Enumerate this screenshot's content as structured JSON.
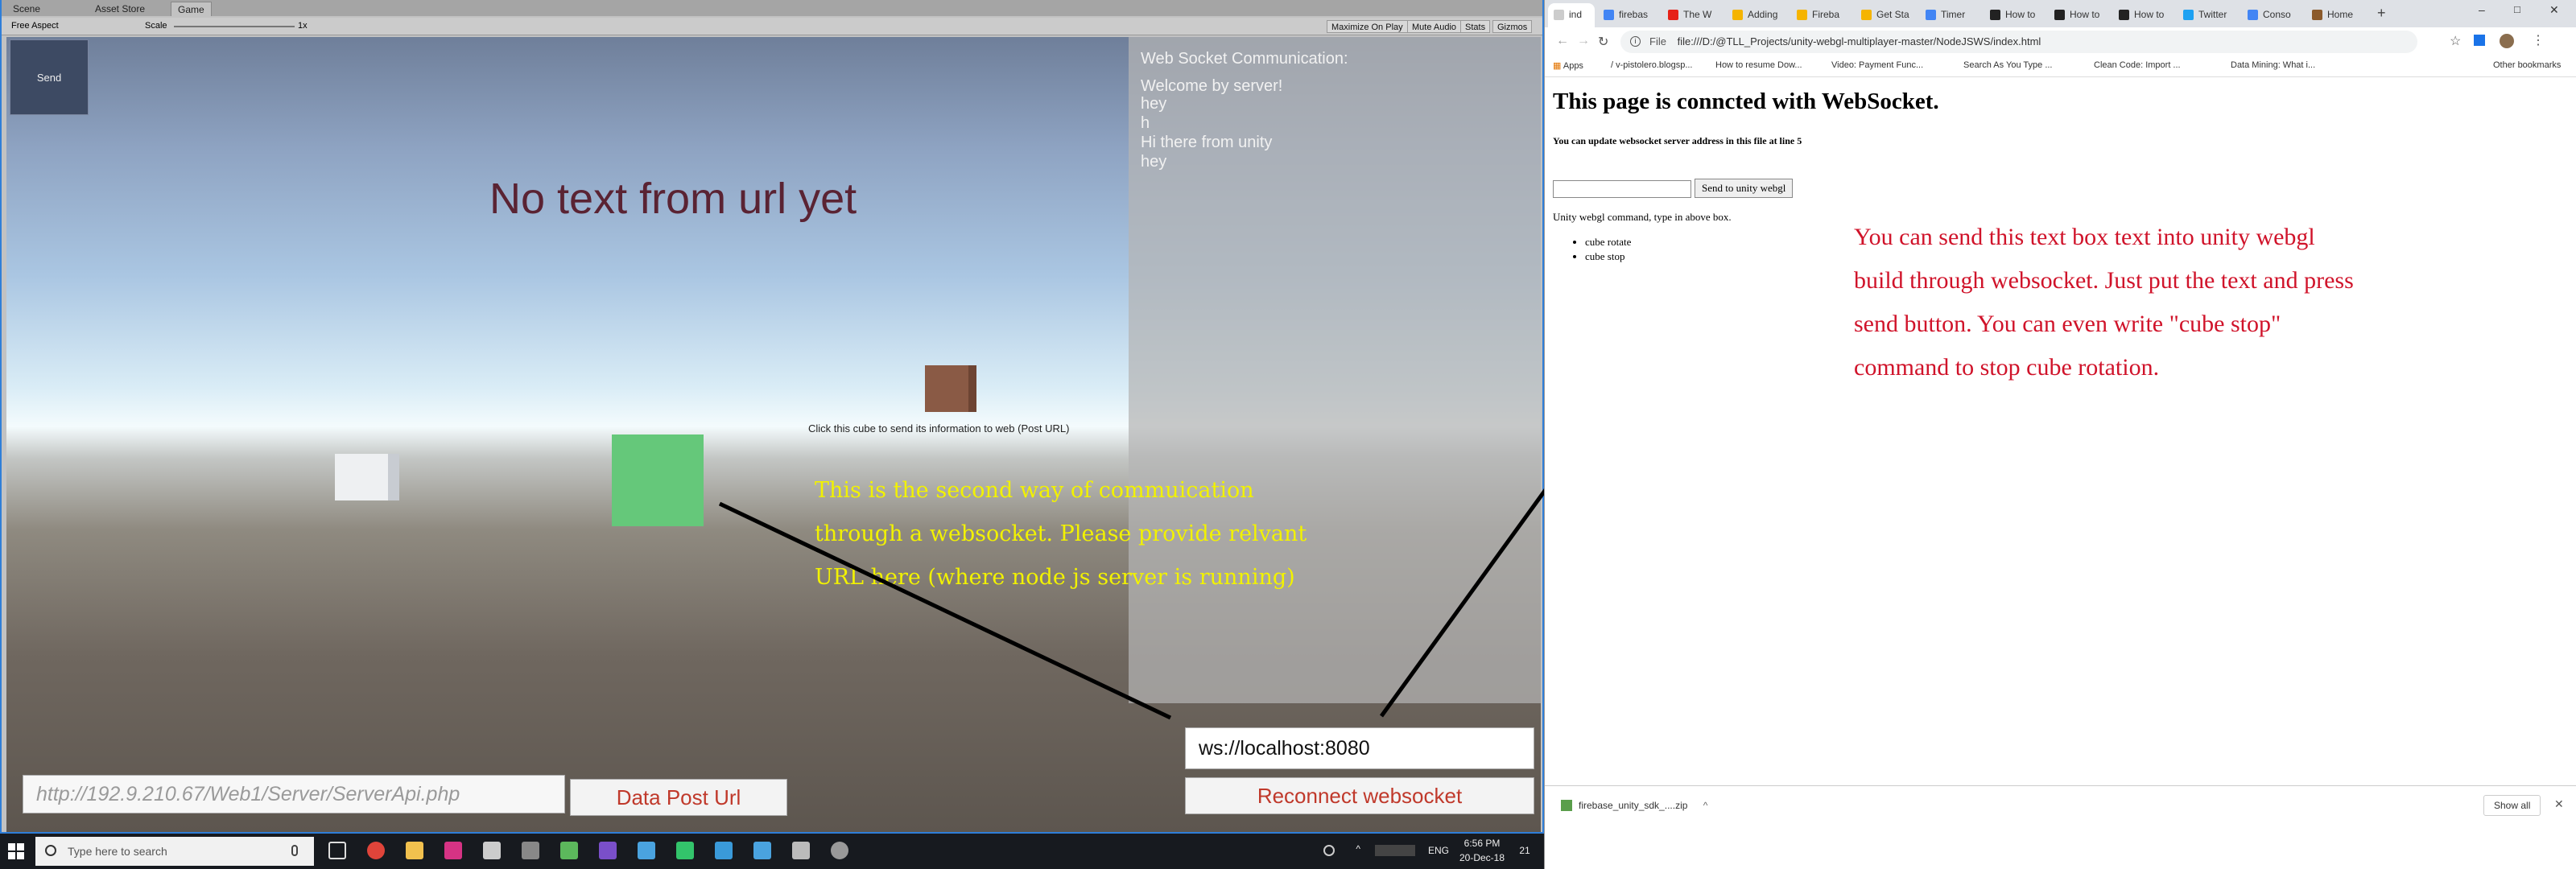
{
  "unity": {
    "tabs": [
      "Scene",
      "Asset Store",
      "Game"
    ],
    "toolbar": {
      "aspect": "Free Aspect",
      "scale_label": "Scale",
      "scale_value": "1x",
      "maximize": "Maximize On Play",
      "mute": "Mute Audio",
      "stats": "Stats",
      "gizmos": "Gizmos"
    },
    "game": {
      "send_button": "Send",
      "no_text": "No text from url yet",
      "ws_panel": {
        "title": "Web Socket Communication:",
        "lines": [
          "Welcome by server!",
          "hey",
          "h",
          "Hi there from unity",
          "hey"
        ]
      },
      "cube_caption": "Click this cube to send its information to web (Post URL)",
      "note_lines": [
        "This is  the second way of commuication",
        "through a websocket. Please provide relvant",
        "URL here (where node js server is running)"
      ],
      "url_placeholder": "http://192.9.210.67/Web1/Server/ServerApi.php",
      "data_post_button": "Data Post Url",
      "ws_value": "ws://localhost:8080",
      "reconnect_button": "Reconnect websocket"
    }
  },
  "taskbar": {
    "search_placeholder": "Type here to search",
    "lang": "ENG",
    "time": "6:56 PM",
    "date": "20-Dec-18",
    "notif_count": "21"
  },
  "chrome": {
    "tabs": [
      "ind",
      "firebas",
      "The W",
      "Adding",
      "Fireba",
      "Get Sta",
      "Timer",
      "How to",
      "How to",
      "How to",
      "Twitter",
      "Conso",
      "Home"
    ],
    "address": "file:///D:/@TLL_Projects/unity-webgl-multiplayer-master/NodeJSWS/index.html",
    "address_scheme": "File",
    "bookmarks": [
      "Apps",
      "/ v-pistolero.blogsp...",
      "How to resume Dow...",
      "Video: Payment Func...",
      "Search As You Type ...",
      "Clean Code: Import ...",
      "Data Mining: What i...",
      "Other bookmarks"
    ],
    "page": {
      "title": "This page is conncted with WebSocket.",
      "subtitle": "You can update websocket server address in this file at line 5",
      "send_button": "Send to unity webgl",
      "hint": "Unity webgl command, type in above box.",
      "commands": [
        "cube rotate",
        "cube stop"
      ],
      "note_lines": [
        "You can send this text box  text into unity webgl",
        "build through websocket. Just put the text and press",
        "send button. You can even write \"cube stop\"",
        "command to stop cube rotation."
      ]
    },
    "download": {
      "file": "firebase_unity_sdk_....zip",
      "show_all": "Show all"
    }
  },
  "colors": {
    "annotation_red": "#d0132a",
    "annotation_yellow": "#f2f200",
    "button_text_red": "#c0392b"
  }
}
